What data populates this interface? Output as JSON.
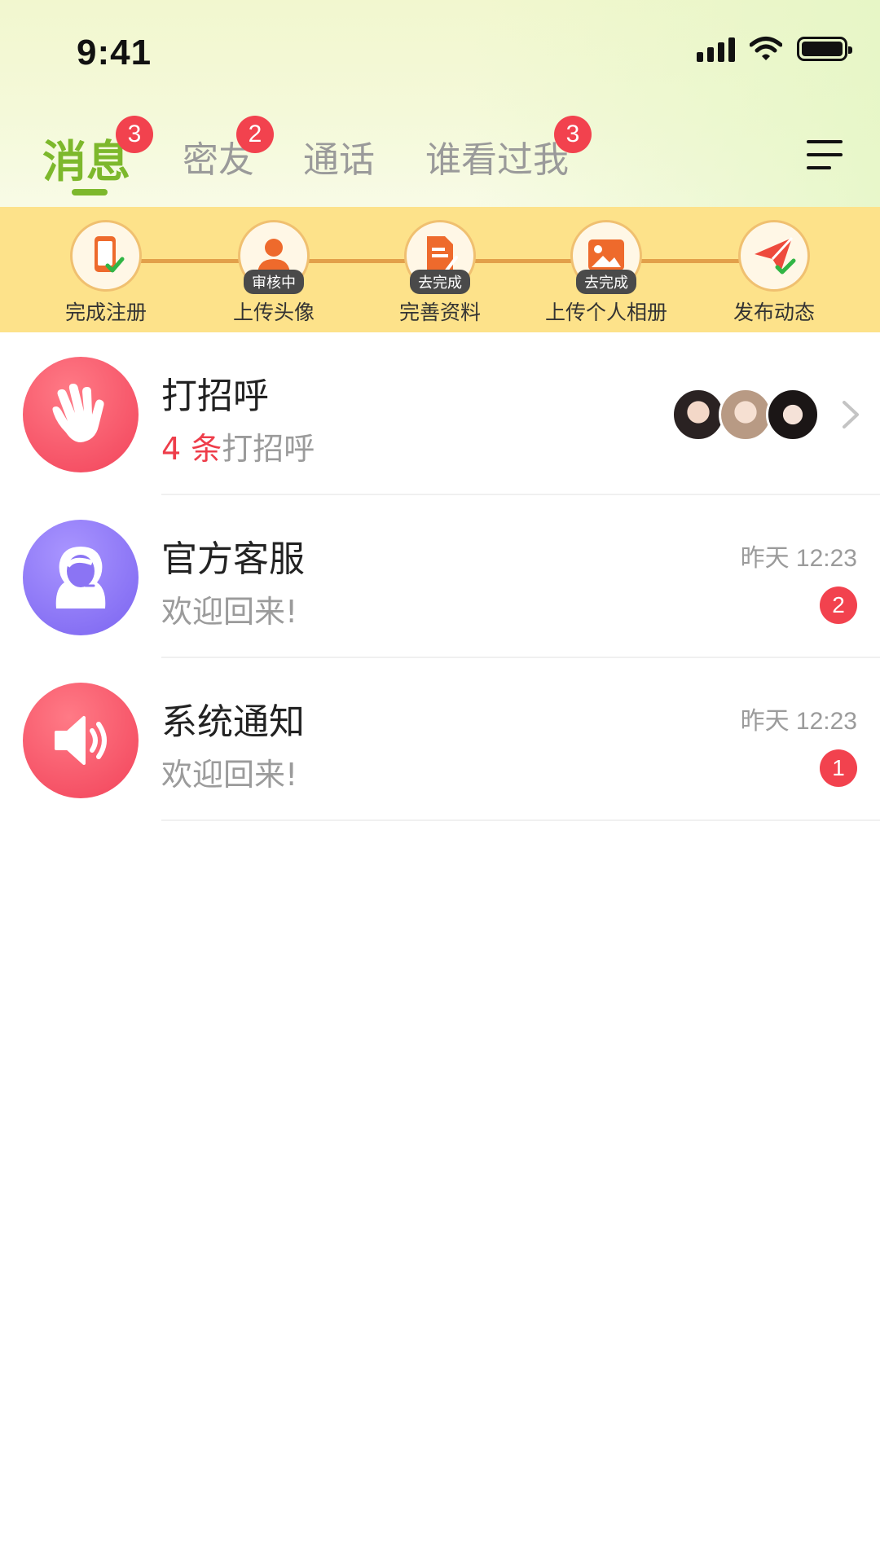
{
  "status_bar": {
    "time": "9:41"
  },
  "tabs": [
    {
      "label": "消息",
      "badge": "3",
      "active": true
    },
    {
      "label": "密友",
      "badge": "2"
    },
    {
      "label": "通话"
    },
    {
      "label": "谁看过我",
      "badge": "3"
    }
  ],
  "menu_icon": "menu-icon",
  "progress_steps": [
    {
      "label": "完成注册",
      "icon": "phone-check-icon"
    },
    {
      "label": "上传头像",
      "icon": "person-icon",
      "tag": "审核中"
    },
    {
      "label": "完善资料",
      "icon": "document-edit-icon",
      "tag": "去完成"
    },
    {
      "label": "上传个人相册",
      "icon": "photo-icon",
      "tag": "去完成"
    },
    {
      "label": "发布动态",
      "icon": "paper-plane-check-icon"
    }
  ],
  "messages": [
    {
      "title": "打招呼",
      "sub_highlight": "4 条",
      "sub": "打招呼",
      "avatar_color": "#f24d5e",
      "icon": "wave-hand-icon"
    },
    {
      "title": "官方客服",
      "sub": "欢迎回来!",
      "time": "昨天 12:23",
      "count": "2",
      "avatar_color": "#8b74f4",
      "icon": "customer-service-icon"
    },
    {
      "title": "系统通知",
      "sub": "欢迎回来!",
      "time": "昨天 12:23",
      "count": "1",
      "avatar_color": "#f24d5e",
      "icon": "speaker-icon"
    }
  ],
  "colors": {
    "accent": "#7db82c",
    "badge": "#f2424e",
    "banner": "#fde28a"
  }
}
